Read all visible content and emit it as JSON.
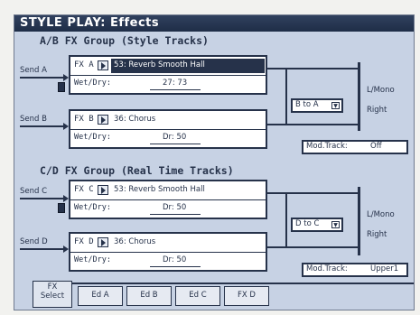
{
  "title": "STYLE PLAY: Effects",
  "groups": [
    {
      "title": "A/B FX Group (Style Tracks)",
      "sends": [
        "Send A",
        "Send B"
      ],
      "fx": [
        {
          "label": "FX A",
          "name": "53: Reverb Smooth Hall",
          "wetdry_label": "Wet/Dry:",
          "wetdry_value": "27: 73",
          "selected": true
        },
        {
          "label": "FX B",
          "name": "36: Chorus",
          "wetdry_label": "Wet/Dry:",
          "wetdry_value": "Dr: 50"
        }
      ],
      "route": "B to A",
      "outputs": "L/Mono\n\nRight",
      "mod_track_label": "Mod.Track:",
      "mod_track_value": "Off"
    },
    {
      "title": "C/D FX Group (Real Time Tracks)",
      "sends": [
        "Send C",
        "Send D"
      ],
      "fx": [
        {
          "label": "FX C",
          "name": "53: Reverb Smooth Hall",
          "wetdry_label": "Wet/Dry:",
          "wetdry_value": "Dr: 50",
          "selected": false
        },
        {
          "label": "FX D",
          "name": "36: Chorus",
          "wetdry_label": "Wet/Dry:",
          "wetdry_value": "Dr: 50"
        }
      ],
      "route": "D to C",
      "outputs": "L/Mono\n\nRight",
      "mod_track_label": "Mod.Track:",
      "mod_track_value": "Upper1"
    }
  ],
  "tabs": [
    "FX\nSelect",
    "Ed A",
    "Ed B",
    "Ed C",
    "FX D"
  ],
  "active_tab": 0,
  "icons": {
    "play": "play-icon",
    "dropdown": "dropdown-arrow-icon"
  },
  "colors": {
    "screen": "#c7d2e4",
    "ink": "#26324a",
    "title_bg": "#1f2d47",
    "highlight": "#26324a"
  }
}
